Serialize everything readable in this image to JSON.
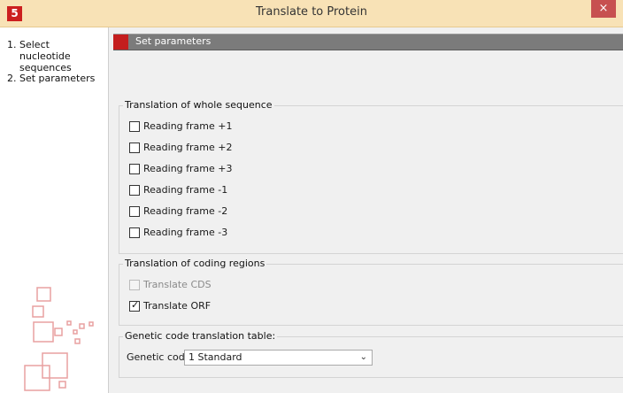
{
  "window": {
    "title": "Translate to Protein",
    "close_label": "×",
    "logo_label": "5"
  },
  "sidebar": {
    "steps": [
      {
        "num": "1.",
        "label": "Select nucleotide sequences"
      },
      {
        "num": "2.",
        "label": "Set parameters"
      }
    ]
  },
  "step_header": {
    "label": "Set parameters"
  },
  "whole_sequence": {
    "title": "Translation of whole sequence",
    "frames": [
      {
        "label": "Reading frame +1",
        "checked": false
      },
      {
        "label": "Reading frame +2",
        "checked": false
      },
      {
        "label": "Reading frame +3",
        "checked": false
      },
      {
        "label": "Reading frame -1",
        "checked": false
      },
      {
        "label": "Reading frame -2",
        "checked": false
      },
      {
        "label": "Reading frame -3",
        "checked": false
      }
    ]
  },
  "coding_regions": {
    "title": "Translation of coding regions",
    "cds": {
      "label": "Translate CDS",
      "checked": false,
      "enabled": false
    },
    "orf": {
      "label": "Translate ORF",
      "checked": true,
      "enabled": true
    }
  },
  "genetic_code": {
    "title": "Genetic code translation table:",
    "label": "Genetic code",
    "selected": "1 Standard"
  },
  "colors": {
    "titlebar": "#f8e2b6",
    "accent": "#c41e1e",
    "panel": "#f0f0f0"
  }
}
